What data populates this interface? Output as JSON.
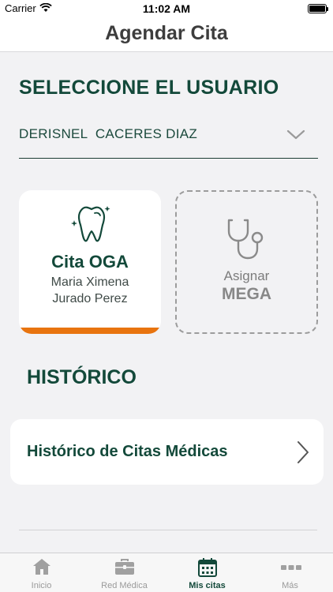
{
  "status_bar": {
    "carrier": "Carrier",
    "time": "11:02 AM"
  },
  "nav": {
    "title": "Agendar Cita"
  },
  "user_section": {
    "title": "SELECCIONE EL USUARIO",
    "selected_user": "DERISNEL  CACERES DIAZ"
  },
  "cards": {
    "oga": {
      "title": "Cita OGA",
      "subtitle_line1": "Maria Ximena",
      "subtitle_line2": "Jurado Perez",
      "accent_color": "#e8740f"
    },
    "mega": {
      "line1": "Asignar",
      "line2": "MEGA"
    }
  },
  "historico": {
    "title": "HISTÓRICO",
    "row_label": "Histórico de Citas Médicas"
  },
  "tab_bar": {
    "tabs": [
      {
        "label": "Inicio",
        "icon": "home-icon",
        "active": false
      },
      {
        "label": "Red Médica",
        "icon": "briefcase-icon",
        "active": false
      },
      {
        "label": "Mis citas",
        "icon": "calendar-icon",
        "active": true
      },
      {
        "label": "Más",
        "icon": "more-icon",
        "active": false
      }
    ]
  },
  "colors": {
    "primary": "#13493a",
    "accent": "#e8740f",
    "background": "#f2f2f4"
  }
}
